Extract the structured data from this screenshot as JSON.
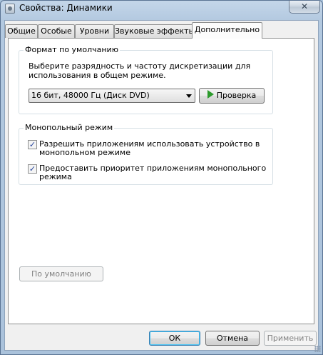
{
  "window": {
    "title": "Свойства: Динамики",
    "close_glyph": "✕"
  },
  "tabs": [
    {
      "label": "Общие",
      "active": false
    },
    {
      "label": "Особые",
      "active": false
    },
    {
      "label": "Уровни",
      "active": false
    },
    {
      "label": "Звуковые эффекты",
      "active": false
    },
    {
      "label": "Дополнительно",
      "active": true
    }
  ],
  "default_format": {
    "group_label": "Формат по умолчанию",
    "description_line1": "Выберите разрядность и частоту дискретизации для",
    "description_line2": "использования в общем режиме.",
    "selected_format": "16 бит, 48000 Гц (Диск DVD)",
    "test_button_label": "Проверка"
  },
  "exclusive_mode": {
    "group_label": "Монопольный режим",
    "options": [
      {
        "line1": "Разрешить приложениям использовать устройство в",
        "line2": "монопольном режиме",
        "checked": true
      },
      {
        "line1": "Предоставить приоритет приложениям монопольного",
        "line2": "режима",
        "checked": true
      }
    ]
  },
  "restore_defaults_label": "По умолчанию",
  "dialog_buttons": {
    "ok": "ОК",
    "cancel": "Отмена",
    "apply": "Применить"
  },
  "colors": {
    "play_icon": "#2c9a2c",
    "check_mark": "#21409a"
  }
}
